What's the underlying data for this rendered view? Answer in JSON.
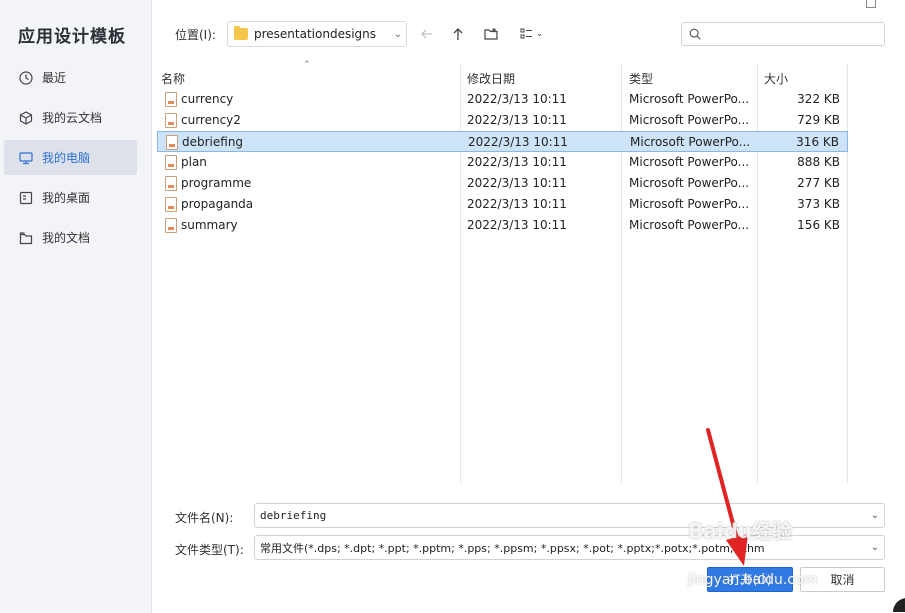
{
  "app": {
    "title": "应用设计模板"
  },
  "sidebar": {
    "items": [
      {
        "label": "最近",
        "icon": "clock-icon",
        "active": false
      },
      {
        "label": "我的云文档",
        "icon": "cloud-cube-icon",
        "active": false
      },
      {
        "label": "我的电脑",
        "icon": "computer-icon",
        "active": true
      },
      {
        "label": "我的桌面",
        "icon": "desktop-icon",
        "active": false
      },
      {
        "label": "我的文档",
        "icon": "documents-icon",
        "active": false
      }
    ]
  },
  "toolbar": {
    "location_label": "位置(I):",
    "location_value": "presentationdesigns",
    "search_placeholder": ""
  },
  "list": {
    "headers": {
      "name": "名称",
      "date": "修改日期",
      "type": "类型",
      "size": "大小"
    },
    "rows": [
      {
        "name": "currency",
        "date": "2022/3/13 10:11",
        "type": "Microsoft PowerPo...",
        "size": "322 KB",
        "selected": false
      },
      {
        "name": "currency2",
        "date": "2022/3/13 10:11",
        "type": "Microsoft PowerPo...",
        "size": "729 KB",
        "selected": false
      },
      {
        "name": "debriefing",
        "date": "2022/3/13 10:11",
        "type": "Microsoft PowerPo...",
        "size": "316 KB",
        "selected": true
      },
      {
        "name": "plan",
        "date": "2022/3/13 10:11",
        "type": "Microsoft PowerPo...",
        "size": "888 KB",
        "selected": false
      },
      {
        "name": "programme",
        "date": "2022/3/13 10:11",
        "type": "Microsoft PowerPo...",
        "size": "277 KB",
        "selected": false
      },
      {
        "name": "propaganda",
        "date": "2022/3/13 10:11",
        "type": "Microsoft PowerPo...",
        "size": "373 KB",
        "selected": false
      },
      {
        "name": "summary",
        "date": "2022/3/13 10:11",
        "type": "Microsoft PowerPo...",
        "size": "156 KB",
        "selected": false
      }
    ]
  },
  "form": {
    "filename_label": "文件名(N):",
    "filename_value": "debriefing",
    "filetype_label": "文件类型(T):",
    "filetype_value": "常用文件(*.dps; *.dpt; *.ppt; *.pptm; *.pps; *.ppsm; *.ppsx; *.pot; *.pptx;*.potx;*.potm;*.thm"
  },
  "buttons": {
    "open": "打开(O)",
    "cancel": "取消"
  },
  "watermark": {
    "text": "Baidu经验",
    "sub": "jingyan.baidu.com"
  },
  "colors": {
    "accent": "#2f7ae5",
    "selected_row": "#cde3f7",
    "annotation": "#e02424"
  }
}
